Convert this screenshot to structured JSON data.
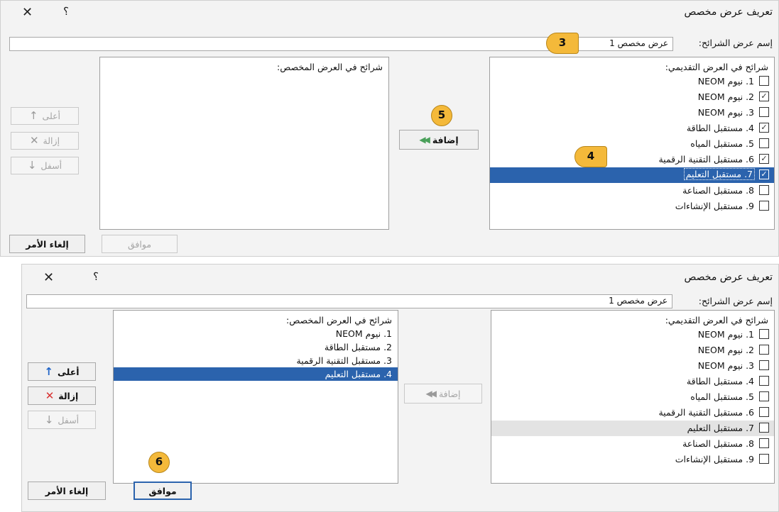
{
  "dialog1": {
    "title": "تعريف عرض مخصص",
    "close_glyph": "✕",
    "help_glyph": "؟",
    "name_label": "إسم عرض الشرائح:",
    "name_value": "عرض مخصص 1",
    "source_header": "شرائح في العرض التقديمي:",
    "source_items": [
      {
        "label": "1. نيوم NEOM",
        "checked": false
      },
      {
        "label": "2. نيوم NEOM",
        "checked": true
      },
      {
        "label": "3. نيوم NEOM",
        "checked": false
      },
      {
        "label": "4. مستقبل الطاقة",
        "checked": true
      },
      {
        "label": "5. مستقبل المياه",
        "checked": false
      },
      {
        "label": "6. مستقبل التقنية الرقمية",
        "checked": true
      },
      {
        "label": "7. مستقبل التعليم",
        "checked": true
      },
      {
        "label": "8. مستقبل الصناعة",
        "checked": false
      },
      {
        "label": "9. مستقبل الإنشاءات",
        "checked": false
      }
    ],
    "selected_index": 6,
    "add_button": "إضافة",
    "custom_header": "شرائح في العرض المخصص:",
    "up_button": "أعلى",
    "remove_button": "إزالة",
    "down_button": "أسفل",
    "ok_button": "موافق",
    "cancel_button": "إلغاء الأمر"
  },
  "dialog2": {
    "title": "تعريف عرض مخصص",
    "close_glyph": "✕",
    "help_glyph": "؟",
    "name_label": "إسم عرض الشرائح:",
    "name_value": "عرض مخصص 1",
    "source_header": "شرائح في العرض التقديمي:",
    "source_items": [
      {
        "label": "1. نيوم NEOM",
        "checked": false
      },
      {
        "label": "2. نيوم NEOM",
        "checked": false
      },
      {
        "label": "3. نيوم NEOM",
        "checked": false
      },
      {
        "label": "4. مستقبل الطاقة",
        "checked": false
      },
      {
        "label": "5. مستقبل المياه",
        "checked": false
      },
      {
        "label": "6. مستقبل التقنية الرقمية",
        "checked": false
      },
      {
        "label": "7. مستقبل التعليم",
        "checked": false
      },
      {
        "label": "8. مستقبل الصناعة",
        "checked": false
      },
      {
        "label": "9. مستقبل الإنشاءات",
        "checked": false
      }
    ],
    "hover_index": 6,
    "add_button": "إضافة",
    "custom_header": "شرائح في العرض المخصص:",
    "custom_items": [
      "1. نيوم NEOM",
      "2. مستقبل الطاقة",
      "3. مستقبل التقنية الرقمية",
      "4. مستقبل التعليم"
    ],
    "custom_selected_index": 3,
    "up_button": "أعلى",
    "remove_button": "إزالة",
    "down_button": "أسفل",
    "ok_button": "موافق",
    "cancel_button": "إلغاء الأمر"
  },
  "callouts": {
    "c3": "3",
    "c4": "4",
    "c5": "5",
    "c6": "6"
  },
  "icons": {
    "arrow_up": "↑",
    "remove": "✕",
    "arrow_down": "↓",
    "add_arrows": "◀◀"
  },
  "colors": {
    "selection": "#2b63ad",
    "callout": "#f4b93a",
    "remove_icon": "#d83232",
    "up_icon": "#1f64c8"
  }
}
